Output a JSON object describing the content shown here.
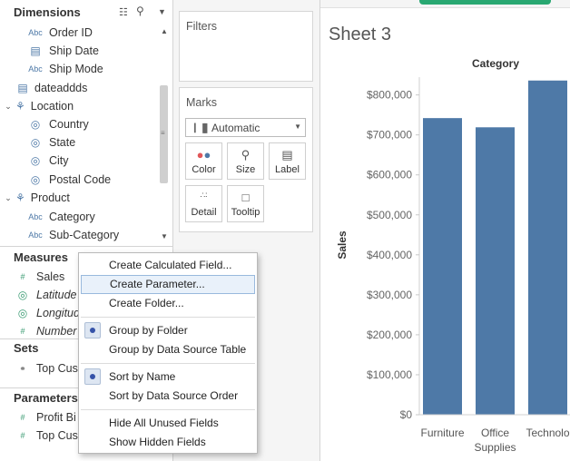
{
  "data_pane": {
    "dimensions_header": "Dimensions",
    "header_icons": [
      "grid-view-icon",
      "search-icon",
      "menu-arrow-icon"
    ],
    "dimension_fields": [
      {
        "icon": "Abc",
        "label": "Order ID"
      },
      {
        "icon": "calendar-icon",
        "label": "Ship Date"
      },
      {
        "icon": "Abc",
        "label": "Ship Mode"
      }
    ],
    "parameter_field": {
      "label": "dateaddds"
    },
    "location_group": {
      "label": "Location",
      "children": [
        "Country",
        "State",
        "City",
        "Postal Code"
      ]
    },
    "product_group": {
      "label": "Product",
      "children": [
        "Category",
        "Sub-Category"
      ]
    },
    "measures_header": "Measures",
    "measure_fields": [
      {
        "icon": "#",
        "label": "Sales",
        "italic": false
      },
      {
        "icon": "globe-icon",
        "label": "Latitude",
        "italic": true
      },
      {
        "icon": "globe-icon",
        "label": "Longitude",
        "italic": true
      },
      {
        "icon": "#",
        "label": "Number",
        "italic": true
      }
    ],
    "sets_header": "Sets",
    "sets_fields": [
      {
        "label": "Top Cus"
      }
    ],
    "parameters_header": "Parameters",
    "parameter_fields": [
      {
        "label": "Profit Bi"
      },
      {
        "label": "Top Cus"
      }
    ]
  },
  "cards": {
    "filters_title": "Filters",
    "marks_title": "Marks",
    "mark_type": "Automatic",
    "mark_buttons": [
      {
        "label": "Color",
        "icon": "color-dots-icon"
      },
      {
        "label": "Size",
        "icon": "size-icon"
      },
      {
        "label": "Label",
        "icon": "label-icon"
      },
      {
        "label": "Detail",
        "icon": "detail-icon"
      },
      {
        "label": "Tooltip",
        "icon": "tooltip-icon"
      }
    ]
  },
  "sheet": {
    "title": "Sheet 3",
    "category_header": "Category"
  },
  "chart_data": {
    "type": "bar",
    "categories": [
      "Furniture",
      "Office Supplies",
      "Technology"
    ],
    "x_tick_labels": [
      "Furniture",
      "Office\nSupplies",
      "Technolo"
    ],
    "values": [
      742000,
      719000,
      836000
    ],
    "title": "",
    "xlabel": "Category",
    "ylabel": "Sales",
    "ylim": [
      0,
      850000
    ],
    "y_ticks": [
      0,
      100000,
      200000,
      300000,
      400000,
      500000,
      600000,
      700000,
      800000
    ],
    "y_tick_labels": [
      "$0",
      "$100,000",
      "$200,000",
      "$300,000",
      "$400,000",
      "$500,000",
      "$600,000",
      "$700,000",
      "$800,000"
    ],
    "bar_color": "#4e79a7",
    "grid": false,
    "legend": "none"
  },
  "context_menu": {
    "items": [
      {
        "label": "Create Calculated Field...",
        "checked": false,
        "highlighted": false
      },
      {
        "label": "Create Parameter...",
        "checked": false,
        "highlighted": true
      },
      {
        "label": "Create Folder...",
        "checked": false,
        "highlighted": false
      },
      {
        "label": "Group by Folder",
        "checked": true,
        "highlighted": false
      },
      {
        "label": "Group by Data Source Table",
        "checked": false,
        "highlighted": false
      },
      {
        "label": "Sort by Name",
        "checked": true,
        "highlighted": false
      },
      {
        "label": "Sort by Data Source Order",
        "checked": false,
        "highlighted": false
      },
      {
        "label": "Hide All Unused Fields",
        "checked": false,
        "highlighted": false
      },
      {
        "label": "Show Hidden Fields",
        "checked": false,
        "highlighted": false
      }
    ]
  },
  "colors": {
    "accent": "#4e79a7",
    "green_field": "#3a9b72",
    "menu_highlight": "#e9f1fa",
    "topbar_pill": "#29a872"
  }
}
